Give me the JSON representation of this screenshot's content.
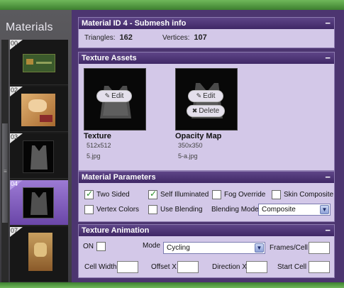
{
  "sidebar": {
    "title": "Materials",
    "items": [
      {
        "num": "00",
        "selected": false
      },
      {
        "num": "02",
        "selected": false
      },
      {
        "num": "03",
        "selected": false
      },
      {
        "num": "04",
        "selected": true
      },
      {
        "num": "07",
        "selected": false
      }
    ]
  },
  "submesh": {
    "title": "Material ID 4 - Submesh info",
    "triangles_label": "Triangles:",
    "triangles_value": "162",
    "vertices_label": "Vertices:",
    "vertices_value": "107"
  },
  "texture_assets": {
    "title": "Texture Assets",
    "texture": {
      "name": "Texture",
      "size": "512x512",
      "file": "5.jpg",
      "edit_label": "Edit"
    },
    "opacity": {
      "name": "Opacity Map",
      "size": "350x350",
      "file": "5-a.jpg",
      "edit_label": "Edit",
      "delete_label": "Delete"
    }
  },
  "material_params": {
    "title": "Material Parameters",
    "two_sided": {
      "label": "Two Sided",
      "checked": true
    },
    "self_illuminated": {
      "label": "Self Illuminated",
      "checked": true
    },
    "fog_override": {
      "label": "Fog Override",
      "checked": false
    },
    "skin_composite": {
      "label": "Skin Composite",
      "checked": false
    },
    "vertex_colors": {
      "label": "Vertex Colors",
      "checked": false
    },
    "use_blending": {
      "label": "Use Blending",
      "checked": false
    },
    "blending_mode_label": "Blending Mode",
    "blending_mode_value": "Composite"
  },
  "texture_animation": {
    "title": "Texture Animation",
    "on_label": "ON",
    "mode_label": "Mode",
    "mode_value": "Cycling",
    "frames_cell_label": "Frames/Cell",
    "cell_width_label": "Cell Width",
    "offset_x_label": "Offset X",
    "direction_x_label": "Direction X",
    "start_cell_label": "Start Cell"
  },
  "icons": {
    "collapse": "−",
    "edit": "✎",
    "delete": "✖",
    "dropdown": "▼"
  },
  "colors": {
    "panel": "#4c3570",
    "section_bg": "#d3c8e8",
    "header": "#5e4587",
    "selected": "#8a66c4",
    "frame_green": "#4a8f3a"
  }
}
